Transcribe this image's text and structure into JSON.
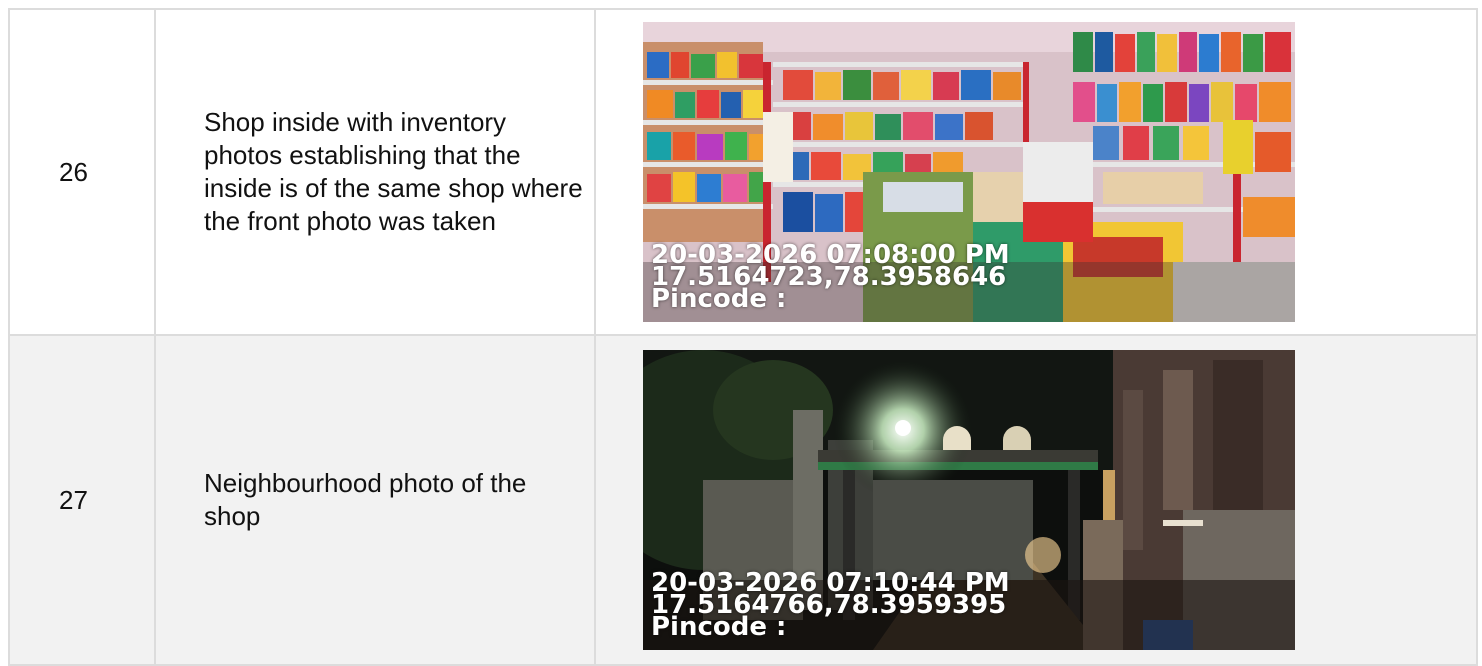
{
  "rows": [
    {
      "number": "26",
      "description": "Shop inside with inventory photos establishing that the inside is of the same shop where the front photo was taken",
      "photo": {
        "datetime": "20-03-2026 07:08:00 PM",
        "coordinates": "17.5164723,78.3958646",
        "pincode": "Pincode :"
      }
    },
    {
      "number": "27",
      "description": "Neighbourhood photo of the shop",
      "photo": {
        "datetime": "20-03-2026 07:10:44 PM",
        "coordinates": "17.5164766,78.3959395",
        "pincode": "Pincode :"
      }
    }
  ],
  "colors": {
    "border": "#dcdcdc",
    "row_alt": "#f2f2f2",
    "stamp_text": "#ffffff"
  }
}
